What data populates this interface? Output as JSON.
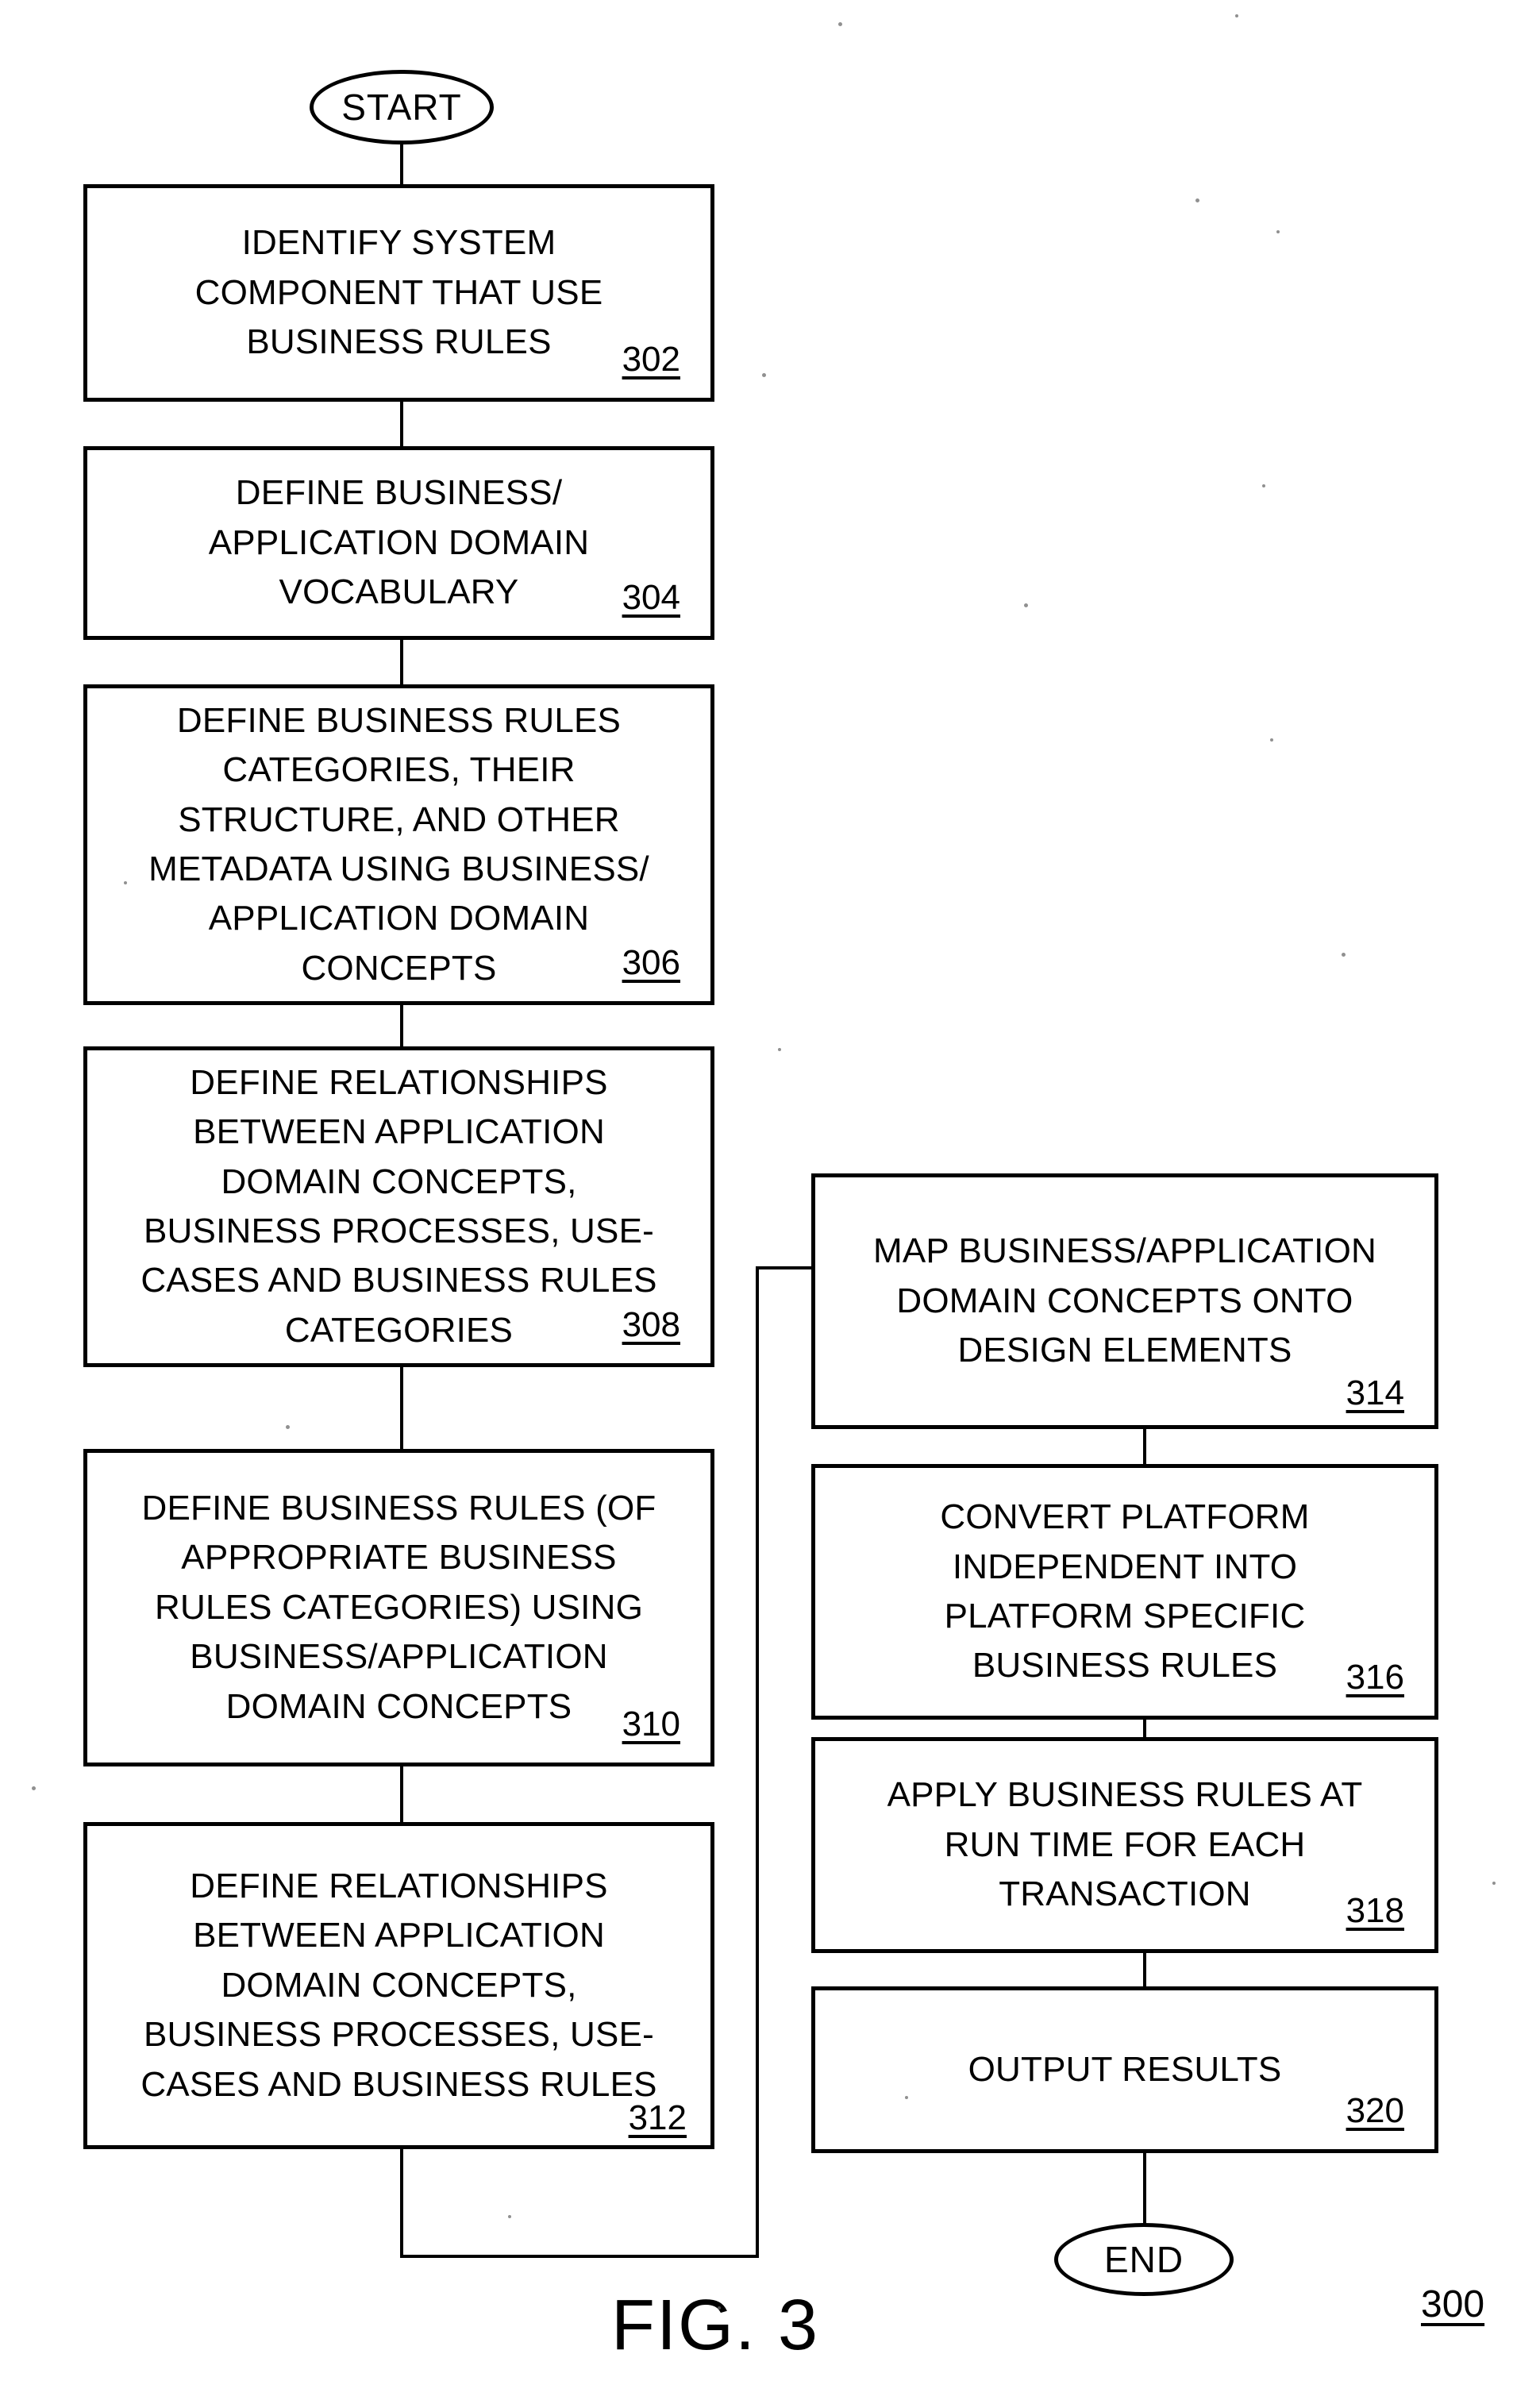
{
  "figure": {
    "caption": "FIG. 3",
    "reference_numeral": "300"
  },
  "terminators": {
    "start": "START",
    "end": "END"
  },
  "left_column": [
    {
      "id": "302",
      "text": "IDENTIFY SYSTEM\nCOMPONENT THAT USE\nBUSINESS RULES",
      "ref": "302"
    },
    {
      "id": "304",
      "text": "DEFINE BUSINESS/\nAPPLICATION DOMAIN\nVOCABULARY",
      "ref": "304"
    },
    {
      "id": "306",
      "text": "DEFINE BUSINESS RULES\nCATEGORIES, THEIR\nSTRUCTURE, AND OTHER\nMETADATA USING BUSINESS/\nAPPLICATION DOMAIN\nCONCEPTS",
      "ref": "306"
    },
    {
      "id": "308",
      "text": "DEFINE RELATIONSHIPS\nBETWEEN APPLICATION\nDOMAIN CONCEPTS,\nBUSINESS PROCESSES, USE-\nCASES AND BUSINESS RULES\nCATEGORIES",
      "ref": "308"
    },
    {
      "id": "310",
      "text": "DEFINE BUSINESS RULES (OF\nAPPROPRIATE BUSINESS\nRULES CATEGORIES) USING\nBUSINESS/APPLICATION\nDOMAIN CONCEPTS",
      "ref": "310"
    },
    {
      "id": "312",
      "text": "DEFINE RELATIONSHIPS\nBETWEEN APPLICATION\nDOMAIN CONCEPTS,\nBUSINESS PROCESSES, USE-\nCASES AND BUSINESS RULES",
      "ref": "312"
    }
  ],
  "right_column": [
    {
      "id": "314",
      "text": "MAP BUSINESS/APPLICATION\nDOMAIN CONCEPTS ONTO\nDESIGN ELEMENTS",
      "ref": "314"
    },
    {
      "id": "316",
      "text": "CONVERT PLATFORM\nINDEPENDENT INTO\nPLATFORM SPECIFIC\nBUSINESS RULES",
      "ref": "316"
    },
    {
      "id": "318",
      "text": "APPLY BUSINESS RULES AT\nRUN TIME FOR EACH\nTRANSACTION",
      "ref": "318"
    },
    {
      "id": "320",
      "text": "OUTPUT RESULTS",
      "ref": "320"
    }
  ],
  "colors": {
    "ink": "#000000",
    "paper": "#ffffff"
  }
}
